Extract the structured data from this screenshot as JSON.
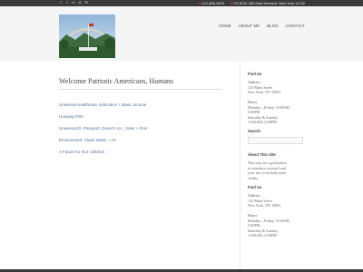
{
  "topbar": {
    "social_icons": [
      "facebook-icon",
      "twitter-icon",
      "linkedin-icon",
      "instagram-icon",
      "email-icon"
    ],
    "phone": "212-555-9670",
    "address": "PO BOX 363 East Norwich, New York 11732"
  },
  "nav": {
    "items": [
      "HOME",
      "ABOUT ME",
      "BLOG",
      "CONTACT"
    ]
  },
  "main": {
    "title": "Welcome Patriotic Americans, Humans",
    "items": [
      "Universal Healthcare, Education + Basic Income",
      "Housing First",
      "Universal ID, Passport, Driver's Lic., Voter + Gun",
      "Environment: Clean Water + Air",
      "A Future for Our Children"
    ]
  },
  "sidebar": {
    "find_us": {
      "heading": "Find Us",
      "address_label": "Address",
      "address_lines": [
        "123 Main Street",
        "New York, NY 10001"
      ],
      "hours_label": "Hours",
      "hours_lines": [
        "Monday—Friday: 9:00AM–",
        "5:00PM",
        "Saturday & Sunday:",
        "11:00AM–3:00PM"
      ]
    },
    "search": {
      "heading": "Search"
    },
    "about": {
      "heading": "About This Site",
      "lines": [
        "This may be a good place",
        "to introduce yourself and",
        "your site or include some",
        "credits."
      ]
    },
    "find_us_2": {
      "heading": "Find Us",
      "address_label": "Address",
      "address_lines": [
        "123 Main Street",
        "New York, NY 10001"
      ],
      "hours_label": "Hours",
      "hours_lines": [
        "Monday—Friday: 9:00AM–",
        "5:00PM",
        "Saturday & Sunday:",
        "11:00AM–3:00PM"
      ]
    }
  }
}
